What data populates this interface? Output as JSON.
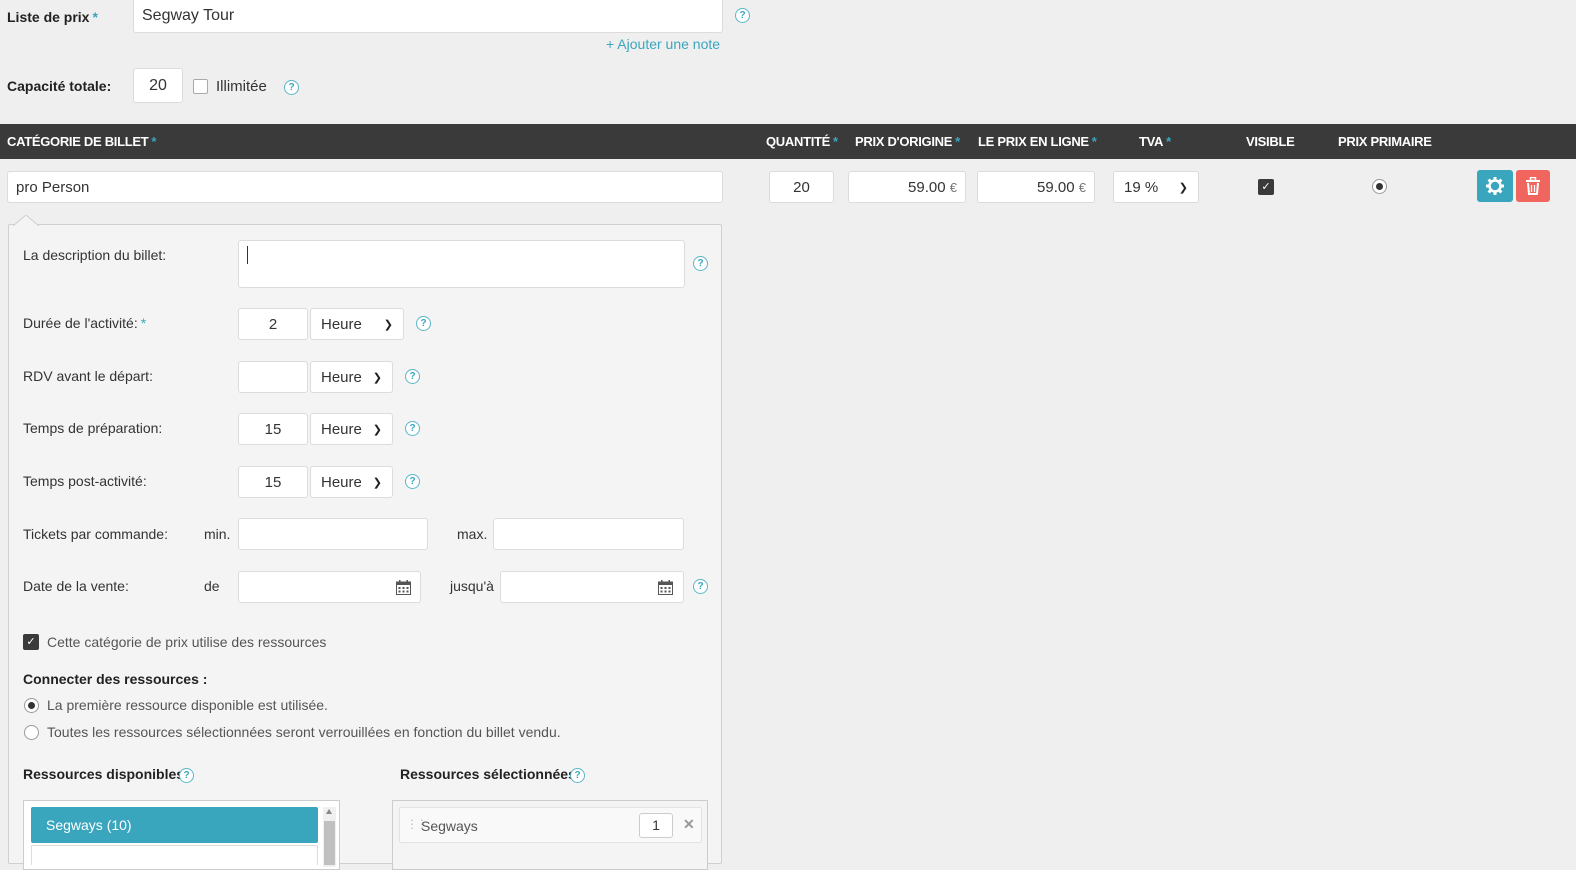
{
  "price_list": {
    "label": "Liste de prix",
    "required": "*",
    "value": "Segway Tour",
    "add_note": "+ Ajouter une note"
  },
  "capacity": {
    "label": "Capacité totale:",
    "value": "20",
    "unlimited_label": "Illimitée",
    "unlimited_checked": false
  },
  "table_header": {
    "category": "CATÉGORIE DE BILLET",
    "quantity": "QUANTITÉ",
    "original_price": "PRIX D'ORIGINE",
    "online_price": "LE PRIX EN LIGNE",
    "vat": "TVA",
    "visible": "VISIBLE",
    "primary_price": "PRIX PRIMAIRE",
    "required": "*"
  },
  "ticket_row": {
    "category": "pro Person",
    "quantity": "20",
    "original_price": "59.00",
    "online_price": "59.00",
    "currency": "€",
    "vat": "19 %",
    "visible": true,
    "primary": true
  },
  "details": {
    "description_label": "La description du billet:",
    "description_value": "",
    "duration_label": "Durée de l'activité:",
    "duration_value": "2",
    "duration_unit": "Heure",
    "meeting_label": "RDV avant le départ:",
    "meeting_value": "",
    "meeting_unit": "Heure",
    "prep_label": "Temps de préparation:",
    "prep_value": "15",
    "prep_unit": "Heure",
    "post_label": "Temps post-activité:",
    "post_value": "15",
    "post_unit": "Heure",
    "tickets_label": "Tickets par commande:",
    "min_label": "min.",
    "max_label": "max.",
    "min_value": "",
    "max_value": "",
    "sale_date_label": "Date de la vente:",
    "from_label": "de",
    "until_label": "jusqu'à",
    "uses_resources_label": "Cette catégorie de prix utilise des ressources",
    "connect_label": "Connecter des ressources :",
    "option_first": "La première ressource disponible est utilisée.",
    "option_all": "Toutes les ressources sélectionnées seront verrouillées en fonction du billet vendu.",
    "available_label": "Ressources disponibles",
    "selected_label": "Ressources sélectionnées",
    "available_items": [
      "Segways (10)"
    ],
    "selected_items": [
      {
        "name": "Segways",
        "qty": "1"
      }
    ]
  },
  "colors": {
    "accent": "#3aa6bd",
    "danger": "#f0665e",
    "header": "#3a3a3a"
  }
}
